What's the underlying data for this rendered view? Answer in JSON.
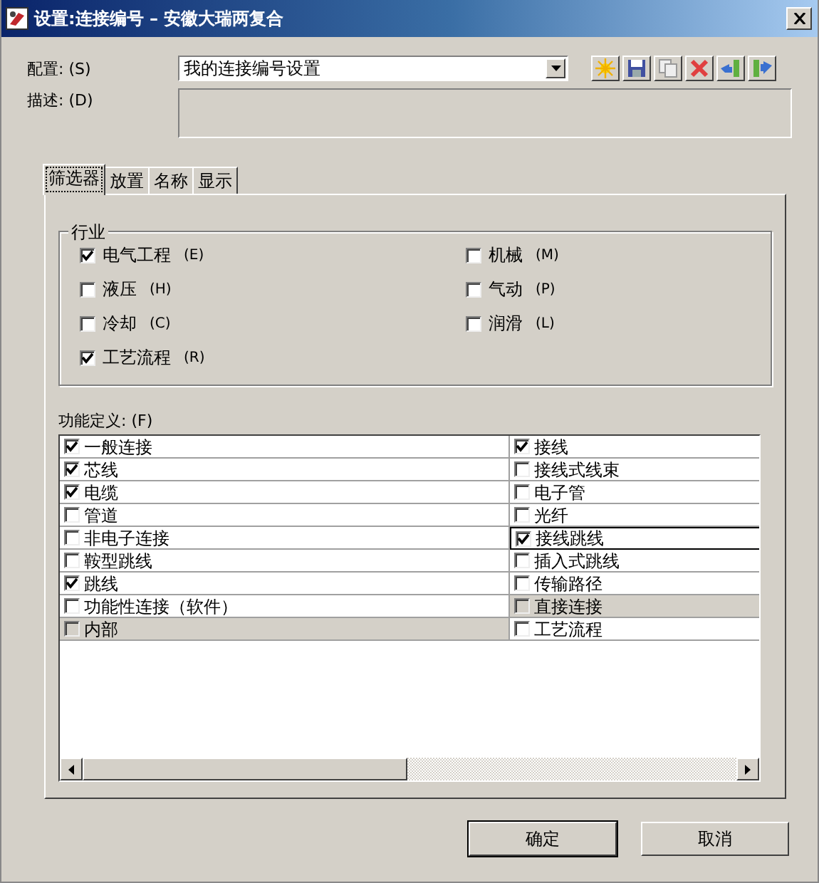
{
  "window": {
    "title": "设置:连接编号 – 安徽大瑞两复合"
  },
  "config": {
    "label": "配置: (S)",
    "value": "我的连接编号设置"
  },
  "toolbar": [
    {
      "kind": "new"
    },
    {
      "kind": "save"
    },
    {
      "kind": "copy"
    },
    {
      "kind": "delete"
    },
    {
      "kind": "import"
    },
    {
      "kind": "export"
    }
  ],
  "description": {
    "label": "描述: (D)"
  },
  "tabs": [
    {
      "label": "筛选器",
      "selected": true
    },
    {
      "label": "放置",
      "selected": false
    },
    {
      "label": "名称",
      "selected": false
    },
    {
      "label": "显示",
      "selected": false
    }
  ],
  "industry": {
    "title": "行业",
    "items": [
      {
        "label": "电气工程",
        "key": "(E)",
        "checked": true
      },
      {
        "label": "机械",
        "key": "(M)",
        "checked": false
      },
      {
        "label": "液压",
        "key": "(H)",
        "checked": false
      },
      {
        "label": "气动",
        "key": "(P)",
        "checked": false
      },
      {
        "label": "冷却",
        "key": "(C)",
        "checked": false
      },
      {
        "label": "润滑",
        "key": "(L)",
        "checked": false
      },
      {
        "label": "工艺流程",
        "key": "(R)",
        "checked": true
      }
    ]
  },
  "function_definition": {
    "label": "功能定义: (F)",
    "rows": [
      [
        {
          "label": "一般连接",
          "checked": true,
          "disabled": false,
          "focused": false
        },
        {
          "label": "接线",
          "checked": true,
          "disabled": false,
          "focused": false
        }
      ],
      [
        {
          "label": "芯线",
          "checked": true,
          "disabled": false,
          "focused": false
        },
        {
          "label": "接线式线束",
          "checked": false,
          "disabled": false,
          "focused": false
        }
      ],
      [
        {
          "label": "电缆",
          "checked": true,
          "disabled": false,
          "focused": false
        },
        {
          "label": "电子管",
          "checked": false,
          "disabled": false,
          "focused": false
        }
      ],
      [
        {
          "label": "管道",
          "checked": false,
          "disabled": false,
          "focused": false
        },
        {
          "label": "光纤",
          "checked": false,
          "disabled": false,
          "focused": false
        }
      ],
      [
        {
          "label": "非电子连接",
          "checked": false,
          "disabled": false,
          "focused": false
        },
        {
          "label": "接线跳线",
          "checked": true,
          "disabled": false,
          "focused": true
        }
      ],
      [
        {
          "label": "鞍型跳线",
          "checked": false,
          "disabled": false,
          "focused": false
        },
        {
          "label": "插入式跳线",
          "checked": false,
          "disabled": false,
          "focused": false
        }
      ],
      [
        {
          "label": "跳线",
          "checked": true,
          "disabled": false,
          "focused": false
        },
        {
          "label": "传输路径",
          "checked": false,
          "disabled": false,
          "focused": false
        }
      ],
      [
        {
          "label": "功能性连接（软件）",
          "checked": false,
          "disabled": false,
          "focused": false
        },
        {
          "label": "直接连接",
          "checked": false,
          "disabled": true,
          "focused": false
        }
      ],
      [
        {
          "label": "内部",
          "checked": false,
          "disabled": true,
          "focused": false
        },
        {
          "label": "工艺流程",
          "checked": false,
          "disabled": false,
          "focused": false
        }
      ]
    ]
  },
  "buttons": [
    {
      "label": "确定"
    },
    {
      "label": "取消"
    }
  ]
}
